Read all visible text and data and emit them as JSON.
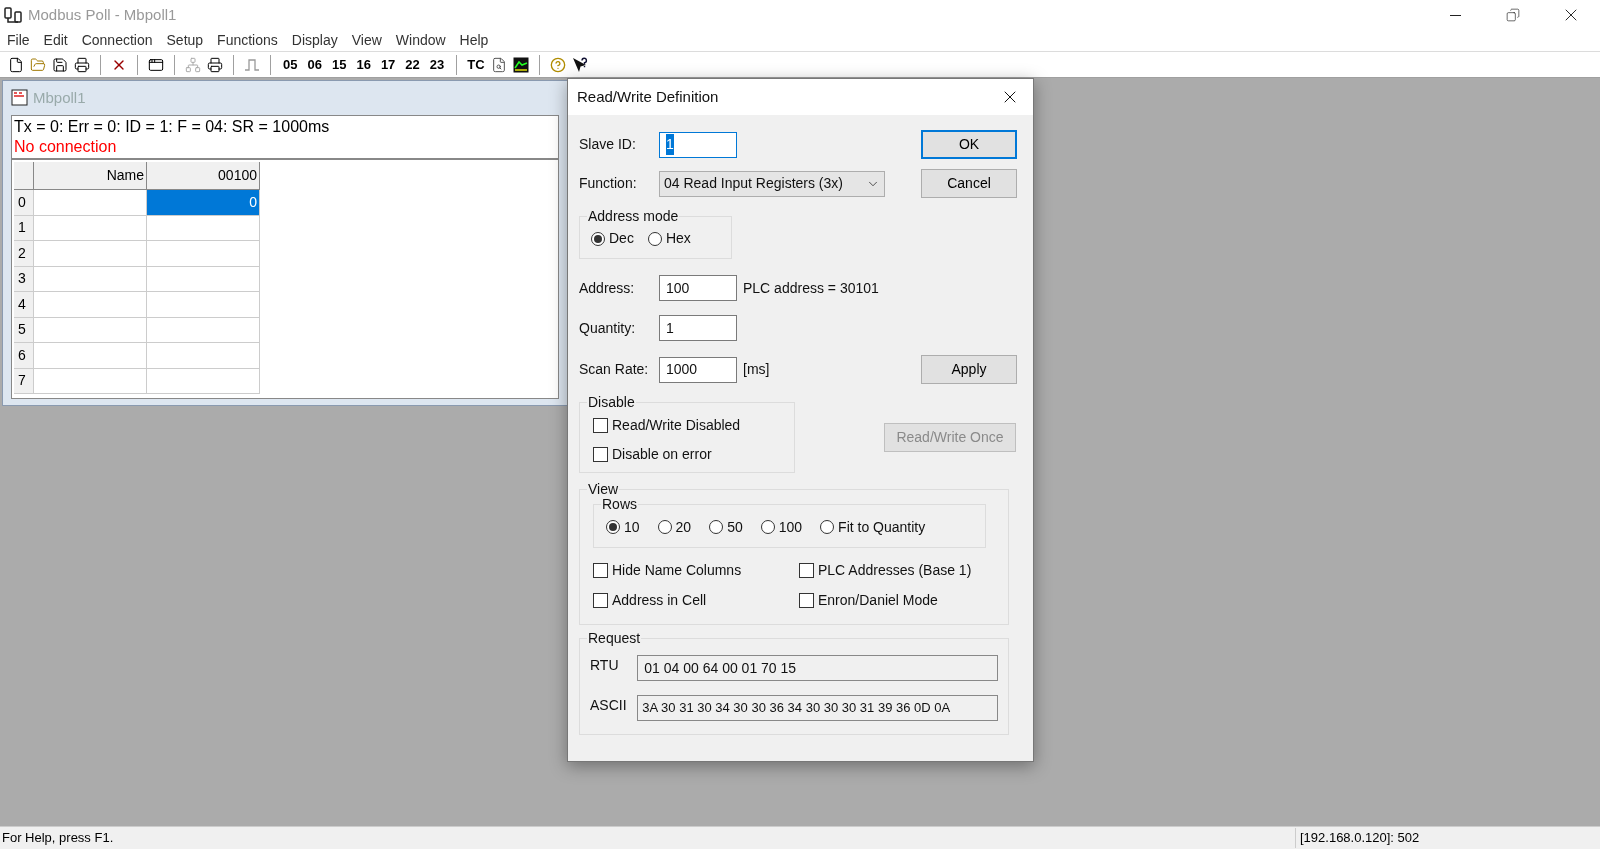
{
  "window": {
    "title": "Modbus Poll - Mbpoll1"
  },
  "menu": [
    "File",
    "Edit",
    "Connection",
    "Setup",
    "Functions",
    "Display",
    "View",
    "Window",
    "Help"
  ],
  "toolbar_codes": [
    "05",
    "06",
    "15",
    "16",
    "17",
    "22",
    "23"
  ],
  "toolbar_tc": "TC",
  "child_window": {
    "title": "Mbpoll1",
    "status_line": "Tx = 0: Err = 0: ID = 1: F = 04: SR = 1000ms",
    "connection": "No connection",
    "columns": [
      "Name",
      "00100"
    ],
    "rows": [
      {
        "label": "0",
        "value": "0",
        "selected": true
      },
      {
        "label": "1",
        "selected": false
      },
      {
        "label": "2",
        "selected": false
      },
      {
        "label": "3",
        "selected": false
      },
      {
        "label": "4",
        "selected": false
      },
      {
        "label": "5",
        "selected": false
      },
      {
        "label": "6",
        "selected": false
      },
      {
        "label": "7",
        "selected": false
      }
    ]
  },
  "dialog": {
    "title": "Read/Write Definition",
    "slave_id": {
      "label": "Slave ID:",
      "value": "1"
    },
    "function": {
      "label": "Function:",
      "value": "04 Read Input Registers (3x)"
    },
    "address_mode": {
      "title": "Address mode",
      "options": [
        {
          "label": "Dec",
          "selected": true
        },
        {
          "label": "Hex",
          "selected": false
        }
      ]
    },
    "address": {
      "label": "Address:",
      "value": "100",
      "note": "PLC address = 30101"
    },
    "quantity": {
      "label": "Quantity:",
      "value": "1"
    },
    "scan_rate": {
      "label": "Scan Rate:",
      "value": "1000",
      "unit": "[ms]"
    },
    "buttons": {
      "ok": "OK",
      "cancel": "Cancel",
      "apply": "Apply",
      "once": "Read/Write Once"
    },
    "once_disabled": true,
    "disable": {
      "title": "Disable",
      "options": [
        {
          "label": "Read/Write Disabled",
          "checked": false
        },
        {
          "label": "Disable on error",
          "checked": false
        }
      ]
    },
    "view": {
      "title": "View",
      "rows_title": "Rows",
      "rows_options": [
        {
          "label": "10",
          "selected": true
        },
        {
          "label": "20",
          "selected": false
        },
        {
          "label": "50",
          "selected": false
        },
        {
          "label": "100",
          "selected": false
        },
        {
          "label": "Fit to Quantity",
          "selected": false
        }
      ],
      "options": [
        {
          "label": "Hide Name Columns",
          "checked": false
        },
        {
          "label": "PLC Addresses (Base 1)",
          "checked": false
        },
        {
          "label": "Address in Cell",
          "checked": false
        },
        {
          "label": "Enron/Daniel Mode",
          "checked": false
        }
      ]
    },
    "request": {
      "title": "Request",
      "rtu_label": "RTU",
      "rtu": "01 04 00 64 00 01 70 15",
      "ascii_label": "ASCII",
      "ascii": "3A 30 31 30 34 30 30 36 34 30 30 30 31 39 36 0D 0A"
    }
  },
  "status_bar": {
    "help": "For Help, press F1.",
    "connection": "[192.168.0.120]: 502"
  }
}
